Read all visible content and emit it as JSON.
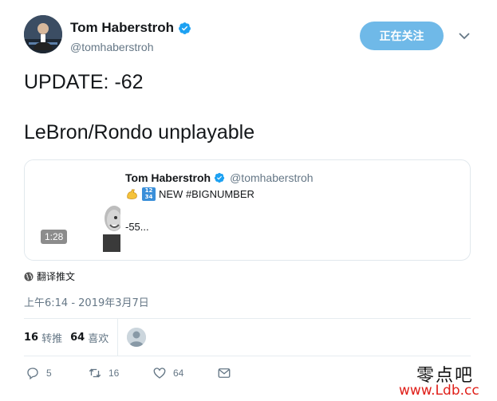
{
  "author": {
    "display_name": "Tom Haberstroh",
    "handle": "@tomhaberstroh",
    "verified": true,
    "follow_button": "正在关注"
  },
  "tweet": {
    "line1": "UPDATE: -62",
    "line2": "LeBron/Rondo unplayable"
  },
  "quoted_tweet": {
    "display_name": "Tom Haberstroh",
    "handle": "@tomhaberstroh",
    "verified": true,
    "text": "NEW #BIGNUMBER",
    "emojis": [
      "flexed-biceps",
      "input-numbers"
    ],
    "numbers_emoji": [
      "12",
      "34"
    ],
    "text2": "-55...",
    "video_duration": "1:28"
  },
  "translate_label": "翻译推文",
  "timestamp": "上午6:14 - 2019年3月7日",
  "stats": {
    "retweets_count": "16",
    "retweets_label": "转推",
    "likes_count": "64",
    "likes_label": "喜欢"
  },
  "actions": {
    "reply_count": "5",
    "retweet_count": "16",
    "like_count": "64"
  },
  "watermark": {
    "line1": "零点吧",
    "line2": "www.Ldb.cc"
  },
  "colors": {
    "follow_button_bg": "#6fb9e8",
    "verified_blue": "#1da1f2",
    "secondary_text": "#657786",
    "watermark_red": "#e0201a"
  }
}
